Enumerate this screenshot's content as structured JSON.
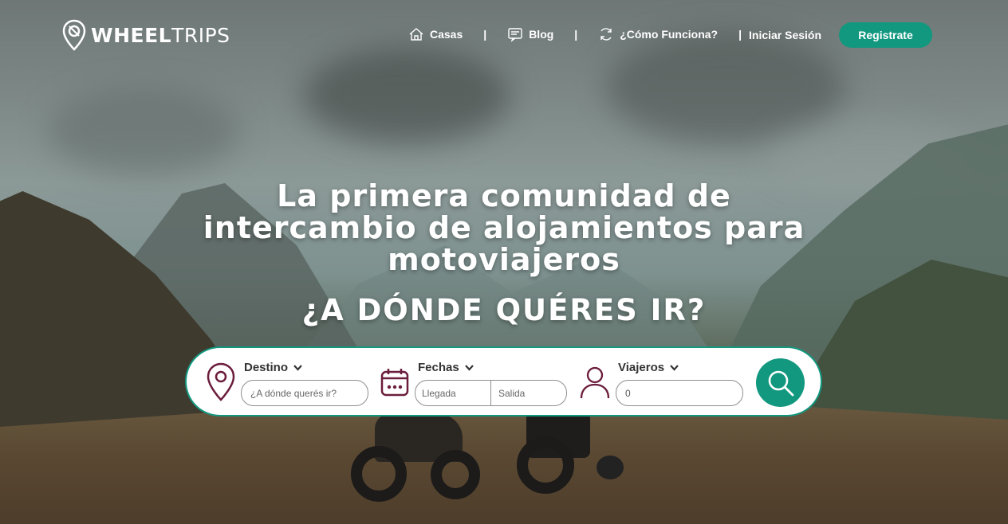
{
  "brand": {
    "name_bold": "WHEEL",
    "name_light": "TRIPS"
  },
  "nav": {
    "items": [
      {
        "label": "Casas",
        "icon": "house-icon"
      },
      {
        "label": "Blog",
        "icon": "blog-icon"
      },
      {
        "label": "¿Cómo Funciona?",
        "icon": "refresh-icon"
      }
    ],
    "separator": "|",
    "login": "Iniciar Sesión",
    "register": "Registrate"
  },
  "hero": {
    "title": "La primera comunidad de intercambio de alojamientos para motoviajeros",
    "subtitle": "¿A DÓNDE QUÉRES IR?"
  },
  "search": {
    "destino": {
      "label": "Destino",
      "placeholder": "¿A dónde querés ir?",
      "icon": "location-pin-icon"
    },
    "fechas": {
      "label": "Fechas",
      "llegada_placeholder": "Llegada",
      "salida_placeholder": "Salida",
      "icon": "calendar-icon"
    },
    "viajeros": {
      "label": "Viajeros",
      "value": "0",
      "icon": "user-icon"
    },
    "button_icon": "search-icon"
  },
  "colors": {
    "accent": "#12987f",
    "brand_dark": "#6b1d3c",
    "white": "#ffffff"
  }
}
